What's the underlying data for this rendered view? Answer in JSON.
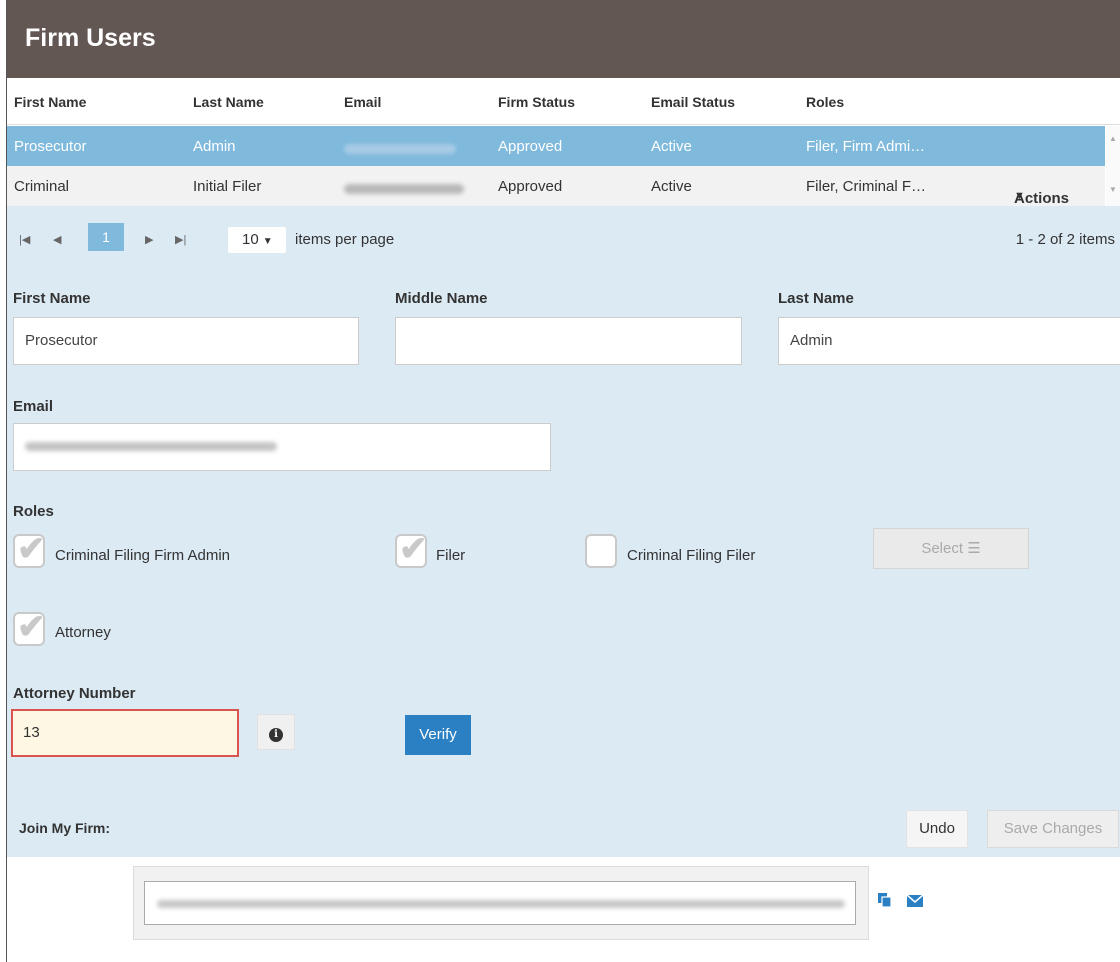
{
  "header": {
    "title": "Firm Users"
  },
  "table": {
    "columns": [
      "First Name",
      "Last Name",
      "Email",
      "Firm Status",
      "Email Status",
      "Roles"
    ],
    "rows": [
      {
        "first": "Prosecutor",
        "last": "Admin",
        "firm_status": "Approved",
        "email_status": "Active",
        "roles": "Filer, Firm Admi…",
        "selected": true
      },
      {
        "first": "Criminal",
        "last": "Initial Filer",
        "firm_status": "Approved",
        "email_status": "Active",
        "roles": "Filer, Criminal F…",
        "actions": "Actions"
      }
    ]
  },
  "pager": {
    "current_page": "1",
    "per_page": "10",
    "per_page_label": "items per page",
    "count_text": "1 - 2 of 2 items"
  },
  "form": {
    "first_name_label": "First Name",
    "first_name_value": "Prosecutor",
    "middle_name_label": "Middle Name",
    "middle_name_value": "",
    "last_name_label": "Last Name",
    "last_name_value": "Admin",
    "email_label": "Email",
    "roles_label": "Roles",
    "roles": [
      {
        "label": "Criminal Filing Firm Admin",
        "checked": true
      },
      {
        "label": "Filer",
        "checked": true
      },
      {
        "label": "Criminal Filing Filer",
        "checked": false
      },
      {
        "label": "Attorney",
        "checked": true
      }
    ],
    "select_button": "Select",
    "attorney_number_label": "Attorney Number",
    "attorney_number_value": "13",
    "verify_button": "Verify",
    "undo_button": "Undo",
    "save_button": "Save Changes"
  },
  "join": {
    "label": "Join My Firm:"
  },
  "colors": {
    "header": "#635753",
    "selected_row": "#7fb9dc",
    "panel": "#dceaf4",
    "verify": "#2b80c4",
    "error_border": "#d9534f"
  },
  "icons": [
    "first-page-icon",
    "prev-page-icon",
    "next-page-icon",
    "last-page-icon",
    "caret-down-icon",
    "list-icon",
    "info-icon",
    "copy-icon",
    "mail-icon",
    "checkmark-icon"
  ]
}
